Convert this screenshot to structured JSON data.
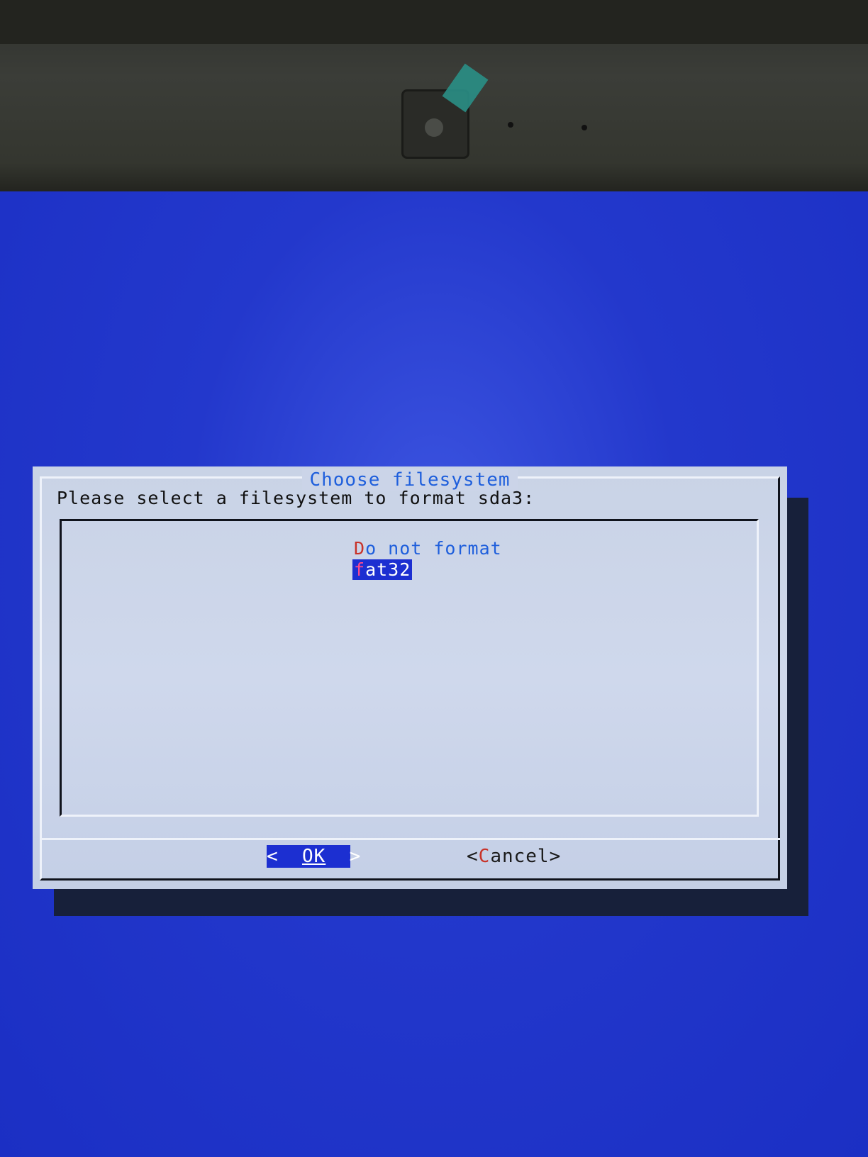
{
  "dialog": {
    "title": "Choose filesystem",
    "prompt": "Please select a filesystem to format sda3:",
    "options": [
      {
        "hotkey": "D",
        "rest": "o not format",
        "selected": false
      },
      {
        "hotkey": "f",
        "rest": "at32",
        "selected": true
      }
    ],
    "buttons": {
      "ok_left": "<",
      "ok_label": "OK",
      "ok_right": ">",
      "cancel_left": "<",
      "cancel_hotkey": "C",
      "cancel_rest": "ancel",
      "cancel_right": ">"
    }
  },
  "colors": {
    "screen_bg": "#1f33c9",
    "dialog_bg": "#cbd4e8",
    "title": "#1f5fdc",
    "highlight": "#1c2fd1",
    "hotkey": "#c83228"
  },
  "icons": [
    "camera-icon"
  ]
}
